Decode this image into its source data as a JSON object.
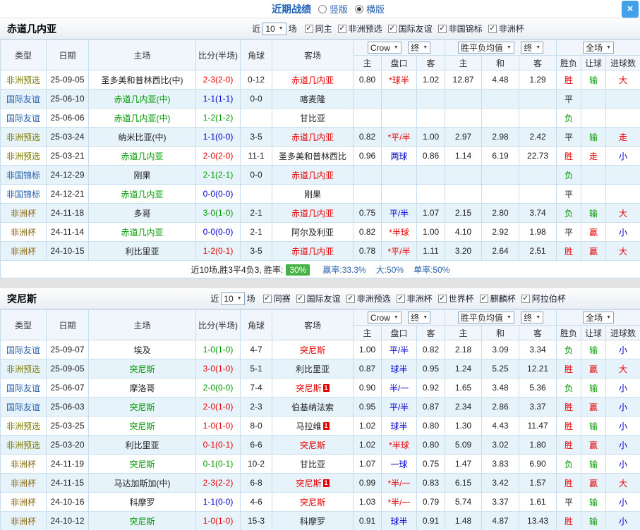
{
  "colors": {
    "accent_blue": "#1f62b8",
    "link_blue": "#2b63ad",
    "win_red": "#e60000",
    "lose_green": "#009900",
    "draw_blue": "#0000cc",
    "type_olive": "#7d7d00",
    "type_brown": "#8b6914",
    "rate_badge_green": "#44b244",
    "close_button_blue": "#42a1e9",
    "row_stripe": "#e7f3fb"
  },
  "topbar": {
    "title": "近期战绩",
    "close_glyph": "×",
    "layout_options": [
      {
        "label": "竖版",
        "selected": false
      },
      {
        "label": "横版",
        "selected": true
      }
    ]
  },
  "sections": [
    {
      "team": "赤道几内亚",
      "filters": {
        "prefix": "近",
        "count": "10",
        "suffix": "场",
        "items": [
          {
            "label": "同主",
            "checked": true
          },
          {
            "label": "非洲预选",
            "checked": true
          },
          {
            "label": "国际友谊",
            "checked": true
          },
          {
            "label": "非国锦标",
            "checked": true
          },
          {
            "label": "非洲杯",
            "checked": true
          }
        ]
      },
      "table": {
        "headers": [
          "类型",
          "日期",
          "主场",
          "比分(半场)",
          "角球",
          "客场"
        ],
        "sub_headers": [
          "主",
          "盘口",
          "客",
          "主",
          "和",
          "客",
          "胜负",
          "让球",
          "进球数"
        ],
        "dropdowns": {
          "company": "Crow",
          "final1": "终",
          "avg": "胜平负均值",
          "final2": "终",
          "scope": "全场"
        },
        "rows": [
          {
            "type": "非洲预选",
            "tc": "o",
            "date": "25-09-05",
            "home": "圣多美和普林西比(中)",
            "hc": "k",
            "score": "2-3(2-0)",
            "sc": "r",
            "corner": "0-12",
            "away": "赤道几内亚",
            "ac": "r",
            "o1": "0.80",
            "line": "*球半",
            "lc": "r",
            "o2": "1.02",
            "a1": "12.87",
            "a2": "4.48",
            "a3": "1.29",
            "r1": "胜",
            "r1c": "r",
            "r2": "输",
            "r2c": "g",
            "r3": "大",
            "r3c": "r"
          },
          {
            "type": "国际友谊",
            "tc": "n",
            "date": "25-06-10",
            "home": "赤道几内亚(中)",
            "hc": "g",
            "score": "1-1(1-1)",
            "sc": "b",
            "corner": "0-0",
            "away": "喀麦隆",
            "ac": "k",
            "o1": "",
            "line": "",
            "lc": "k",
            "o2": "",
            "a1": "",
            "a2": "",
            "a3": "",
            "r1": "平",
            "r1c": "k",
            "r2": "",
            "r2c": "k",
            "r3": "",
            "r3c": "k"
          },
          {
            "type": "国际友谊",
            "tc": "n",
            "date": "25-06-06",
            "home": "赤道几内亚(中)",
            "hc": "g",
            "score": "1-2(1-2)",
            "sc": "g",
            "corner": "",
            "away": "甘比亚",
            "ac": "k",
            "o1": "",
            "line": "",
            "lc": "k",
            "o2": "",
            "a1": "",
            "a2": "",
            "a3": "",
            "r1": "负",
            "r1c": "g",
            "r2": "",
            "r2c": "k",
            "r3": "",
            "r3c": "k"
          },
          {
            "type": "非洲预选",
            "tc": "o",
            "date": "25-03-24",
            "home": "纳米比亚(中)",
            "hc": "k",
            "score": "1-1(0-0)",
            "sc": "b",
            "corner": "3-5",
            "away": "赤道几内亚",
            "ac": "r",
            "o1": "0.82",
            "line": "*平/半",
            "lc": "r",
            "o2": "1.00",
            "a1": "2.97",
            "a2": "2.98",
            "a3": "2.42",
            "r1": "平",
            "r1c": "k",
            "r2": "输",
            "r2c": "g",
            "r3": "走",
            "r3c": "r"
          },
          {
            "type": "非洲预选",
            "tc": "o",
            "date": "25-03-21",
            "home": "赤道几内亚",
            "hc": "g",
            "score": "2-0(2-0)",
            "sc": "r",
            "corner": "11-1",
            "away": "圣多美和普林西比",
            "ac": "k",
            "o1": "0.96",
            "line": "两球",
            "lc": "b",
            "o2": "0.86",
            "a1": "1.14",
            "a2": "6.19",
            "a3": "22.73",
            "r1": "胜",
            "r1c": "r",
            "r2": "走",
            "r2c": "r",
            "r3": "小",
            "r3c": "b"
          },
          {
            "type": "非国锦标",
            "tc": "n",
            "date": "24-12-29",
            "home": "刚果",
            "hc": "k",
            "score": "2-1(2-1)",
            "sc": "g",
            "corner": "0-0",
            "away": "赤道几内亚",
            "ac": "r",
            "o1": "",
            "line": "",
            "lc": "k",
            "o2": "",
            "a1": "",
            "a2": "",
            "a3": "",
            "r1": "负",
            "r1c": "g",
            "r2": "",
            "r2c": "k",
            "r3": "",
            "r3c": "k"
          },
          {
            "type": "非国锦标",
            "tc": "n",
            "date": "24-12-21",
            "home": "赤道几内亚",
            "hc": "g",
            "score": "0-0(0-0)",
            "sc": "b",
            "corner": "",
            "away": "刚果",
            "ac": "k",
            "o1": "",
            "line": "",
            "lc": "k",
            "o2": "",
            "a1": "",
            "a2": "",
            "a3": "",
            "r1": "平",
            "r1c": "k",
            "r2": "",
            "r2c": "k",
            "r3": "",
            "r3c": "k"
          },
          {
            "type": "非洲杯",
            "tc": "o2",
            "date": "24-11-18",
            "home": "多哥",
            "hc": "k",
            "score": "3-0(1-0)",
            "sc": "g",
            "corner": "2-1",
            "away": "赤道几内亚",
            "ac": "r",
            "o1": "0.75",
            "line": "平/半",
            "lc": "b",
            "o2": "1.07",
            "a1": "2.15",
            "a2": "2.80",
            "a3": "3.74",
            "r1": "负",
            "r1c": "g",
            "r2": "输",
            "r2c": "g",
            "r3": "大",
            "r3c": "r"
          },
          {
            "type": "非洲杯",
            "tc": "o2",
            "date": "24-11-14",
            "home": "赤道几内亚",
            "hc": "g",
            "score": "0-0(0-0)",
            "sc": "b",
            "corner": "2-1",
            "away": "阿尔及利亚",
            "ac": "k",
            "o1": "0.82",
            "line": "*半球",
            "lc": "r",
            "o2": "1.00",
            "a1": "4.10",
            "a2": "2.92",
            "a3": "1.98",
            "r1": "平",
            "r1c": "k",
            "r2": "赢",
            "r2c": "r",
            "r3": "小",
            "r3c": "b"
          },
          {
            "type": "非洲杯",
            "tc": "o2",
            "date": "24-10-15",
            "home": "利比里亚",
            "hc": "k",
            "score": "1-2(0-1)",
            "sc": "r",
            "corner": "3-5",
            "away": "赤道几内亚",
            "ac": "r",
            "o1": "0.78",
            "line": "*平/半",
            "lc": "r",
            "o2": "1.11",
            "a1": "3.20",
            "a2": "2.64",
            "a3": "2.51",
            "r1": "胜",
            "r1c": "r",
            "r2": "赢",
            "r2c": "r",
            "r3": "大",
            "r3c": "r"
          }
        ]
      },
      "summary": {
        "prefix": "近10场,胜3平4负3, 胜率:",
        "win_rate": "30%",
        "stats": [
          "赢率:33.3%",
          "大:50%",
          "单率:50%"
        ]
      }
    },
    {
      "team": "突尼斯",
      "filters": {
        "prefix": "近",
        "count": "10",
        "suffix": "场",
        "items": [
          {
            "label": "同赛",
            "checked": true
          },
          {
            "label": "国际友谊",
            "checked": true
          },
          {
            "label": "非洲预选",
            "checked": true
          },
          {
            "label": "非洲杯",
            "checked": true
          },
          {
            "label": "世界杯",
            "checked": true
          },
          {
            "label": "麒麟杯",
            "checked": true
          },
          {
            "label": "阿拉伯杯",
            "checked": true
          }
        ]
      },
      "table": {
        "headers": [
          "类型",
          "日期",
          "主场",
          "比分(半场)",
          "角球",
          "客场"
        ],
        "sub_headers": [
          "主",
          "盘口",
          "客",
          "主",
          "和",
          "客",
          "胜负",
          "让球",
          "进球数"
        ],
        "dropdowns": {
          "company": "Crow",
          "final1": "终",
          "avg": "胜平负均值",
          "final2": "终",
          "scope": "全场"
        },
        "rows": [
          {
            "type": "国际友谊",
            "tc": "n",
            "date": "25-09-07",
            "home": "埃及",
            "hc": "k",
            "score": "1-0(1-0)",
            "sc": "g",
            "corner": "4-7",
            "away": "突尼斯",
            "ac": "r",
            "o1": "1.00",
            "line": "平/半",
            "lc": "b",
            "o2": "0.82",
            "a1": "2.18",
            "a2": "3.09",
            "a3": "3.34",
            "r1": "负",
            "r1c": "g",
            "r2": "输",
            "r2c": "g",
            "r3": "小",
            "r3c": "b"
          },
          {
            "type": "非洲预选",
            "tc": "o",
            "date": "25-09-05",
            "home": "突尼斯",
            "hc": "g",
            "score": "3-0(1-0)",
            "sc": "r",
            "corner": "5-1",
            "away": "利比里亚",
            "ac": "k",
            "o1": "0.87",
            "line": "球半",
            "lc": "b",
            "o2": "0.95",
            "a1": "1.24",
            "a2": "5.25",
            "a3": "12.21",
            "r1": "胜",
            "r1c": "r",
            "r2": "赢",
            "r2c": "r",
            "r3": "大",
            "r3c": "r"
          },
          {
            "type": "国际友谊",
            "tc": "n",
            "date": "25-06-07",
            "home": "摩洛哥",
            "hc": "k",
            "score": "2-0(0-0)",
            "sc": "g",
            "corner": "7-4",
            "away": "突尼斯",
            "ac": "r",
            "abadge": "1",
            "o1": "0.90",
            "line": "半/一",
            "lc": "b",
            "o2": "0.92",
            "a1": "1.65",
            "a2": "3.48",
            "a3": "5.36",
            "r1": "负",
            "r1c": "g",
            "r2": "输",
            "r2c": "g",
            "r3": "小",
            "r3c": "b"
          },
          {
            "type": "国际友谊",
            "tc": "n",
            "date": "25-06-03",
            "home": "突尼斯",
            "hc": "g",
            "score": "2-0(1-0)",
            "sc": "r",
            "corner": "2-3",
            "away": "伯基纳法索",
            "ac": "k",
            "o1": "0.95",
            "line": "平/半",
            "lc": "b",
            "o2": "0.87",
            "a1": "2.34",
            "a2": "2.86",
            "a3": "3.37",
            "r1": "胜",
            "r1c": "r",
            "r2": "赢",
            "r2c": "r",
            "r3": "小",
            "r3c": "b"
          },
          {
            "type": "非洲预选",
            "tc": "o",
            "date": "25-03-25",
            "home": "突尼斯",
            "hc": "g",
            "score": "1-0(1-0)",
            "sc": "r",
            "corner": "8-0",
            "away": "马拉维",
            "ac": "k",
            "abadge": "1",
            "o1": "1.02",
            "line": "球半",
            "lc": "b",
            "o2": "0.80",
            "a1": "1.30",
            "a2": "4.43",
            "a3": "11.47",
            "r1": "胜",
            "r1c": "r",
            "r2": "输",
            "r2c": "g",
            "r3": "小",
            "r3c": "b"
          },
          {
            "type": "非洲预选",
            "tc": "o",
            "date": "25-03-20",
            "home": "利比里亚",
            "hc": "k",
            "score": "0-1(0-1)",
            "sc": "r",
            "corner": "6-6",
            "away": "突尼斯",
            "ac": "r",
            "o1": "1.02",
            "line": "*半球",
            "lc": "r",
            "o2": "0.80",
            "a1": "5.09",
            "a2": "3.02",
            "a3": "1.80",
            "r1": "胜",
            "r1c": "r",
            "r2": "赢",
            "r2c": "r",
            "r3": "小",
            "r3c": "b"
          },
          {
            "type": "非洲杯",
            "tc": "o2",
            "date": "24-11-19",
            "home": "突尼斯",
            "hc": "g",
            "score": "0-1(0-1)",
            "sc": "g",
            "corner": "10-2",
            "away": "甘比亚",
            "ac": "k",
            "o1": "1.07",
            "line": "一球",
            "lc": "b",
            "o2": "0.75",
            "a1": "1.47",
            "a2": "3.83",
            "a3": "6.90",
            "r1": "负",
            "r1c": "g",
            "r2": "输",
            "r2c": "g",
            "r3": "小",
            "r3c": "b"
          },
          {
            "type": "非洲杯",
            "tc": "o2",
            "date": "24-11-15",
            "home": "马达加斯加(中)",
            "hc": "k",
            "score": "2-3(2-2)",
            "sc": "r",
            "corner": "6-8",
            "away": "突尼斯",
            "ac": "r",
            "abadge": "1",
            "o1": "0.99",
            "line": "*半/一",
            "lc": "r",
            "o2": "0.83",
            "a1": "6.15",
            "a2": "3.42",
            "a3": "1.57",
            "r1": "胜",
            "r1c": "r",
            "r2": "赢",
            "r2c": "r",
            "r3": "大",
            "r3c": "r"
          },
          {
            "type": "非洲杯",
            "tc": "o2",
            "date": "24-10-16",
            "home": "科摩罗",
            "hc": "k",
            "score": "1-1(0-0)",
            "sc": "b",
            "corner": "4-6",
            "away": "突尼斯",
            "ac": "r",
            "o1": "1.03",
            "line": "*半/一",
            "lc": "r",
            "o2": "0.79",
            "a1": "5.74",
            "a2": "3.37",
            "a3": "1.61",
            "r1": "平",
            "r1c": "k",
            "r2": "输",
            "r2c": "g",
            "r3": "小",
            "r3c": "b"
          },
          {
            "type": "非洲杯",
            "tc": "o2",
            "date": "24-10-12",
            "home": "突尼斯",
            "hc": "g",
            "score": "1-0(1-0)",
            "sc": "r",
            "corner": "15-3",
            "away": "科摩罗",
            "ac": "k",
            "o1": "0.91",
            "line": "球半",
            "lc": "b",
            "o2": "0.91",
            "a1": "1.48",
            "a2": "4.87",
            "a3": "13.43",
            "r1": "胜",
            "r1c": "r",
            "r2": "输",
            "r2c": "g",
            "r3": "小",
            "r3c": "b"
          }
        ]
      }
    }
  ]
}
